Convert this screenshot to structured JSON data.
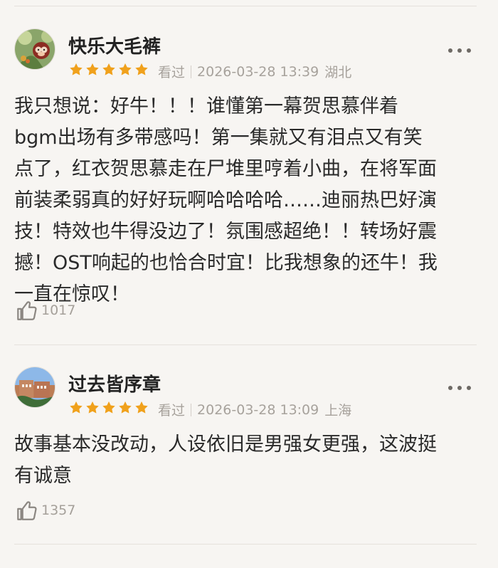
{
  "reviews": [
    {
      "user": "快乐大毛裤",
      "stars": 5,
      "status": "看过",
      "datetime": "2026-03-28 13:39",
      "location": "湖北",
      "text": "我只想说：好牛！！！谁懂第一幕贺思慕伴着\nbgm出场有多带感吗！第一集就又有泪点又有笑\n点了，红衣贺思慕走在尸堆里哼着小曲，在将军面\n前装柔弱真的好好玩啊哈哈哈哈……迪丽热巴好演\n技！特效也牛得没边了！氛围感超绝！！转场好震\n撼！OST响起的也恰合时宜！比我想象的还牛！我\n一直在惊叹！",
      "likes": "1017"
    },
    {
      "user": "过去皆序章",
      "stars": 5,
      "status": "看过",
      "datetime": "2026-03-28 13:09",
      "location": "上海",
      "text": "故事基本没改动，人设依旧是男强女更强，这波挺\n有诚意",
      "likes": "1357"
    }
  ],
  "colors": {
    "star": "#f0a11c",
    "background": "#f7f5f2",
    "muted": "#a7a29c"
  },
  "icons": {
    "star": "star-icon",
    "like": "thumbs-up-icon",
    "more": "more-icon"
  }
}
